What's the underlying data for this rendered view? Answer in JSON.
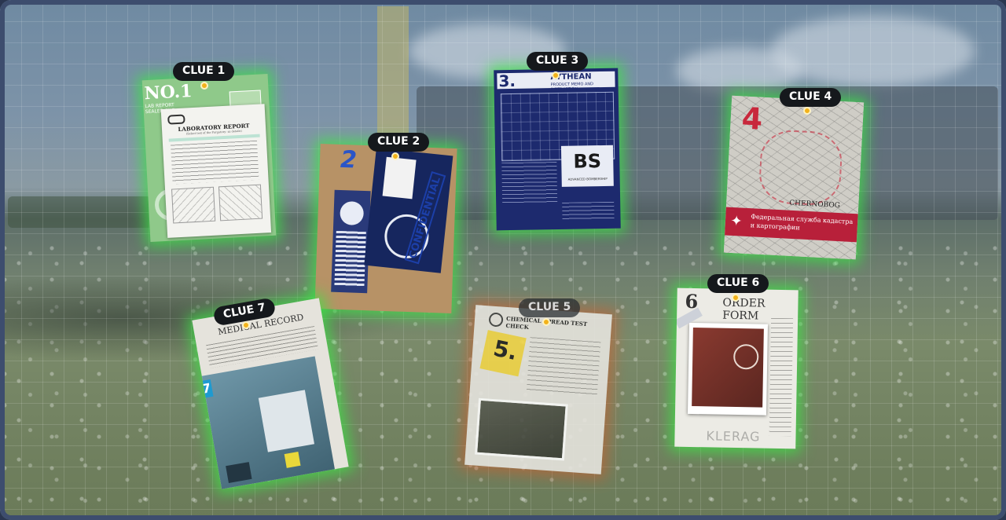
{
  "board": {
    "title": ""
  },
  "colors": {
    "found_glow": "#3ce646",
    "pending_glow": "#dc5a28",
    "pin": "#f2b21b",
    "pill": "#15181c"
  },
  "clues": [
    {
      "id": 1,
      "label": "CLUE 1",
      "badge": "NO.1",
      "subtitle": "LAB REPORT SEALED FILE",
      "doc_title": "LABORATORY REPORT",
      "doc_sub": "(Select test of the Purgatory: xx details)"
    },
    {
      "id": 2,
      "label": "CLUE 2",
      "number": "2",
      "stamp": "CONFIDENTIAL"
    },
    {
      "id": 3,
      "label": "CLUE 3",
      "number": "3.",
      "brand": "AYTHEAN",
      "doc_sub": "PRODUCT MEMO AND INSTRUCTION",
      "logo": "BS",
      "logo_sub": "ADVANCED BOMBERSHIP"
    },
    {
      "id": 4,
      "label": "CLUE 4",
      "number": "4",
      "map_place": "CHERNOBOG",
      "banner": "Федеральная служба кадастра и картографии"
    },
    {
      "id": 5,
      "label": "CLUE 5",
      "number": "5.",
      "header": "CHEMICAL SPREAD TEST CHECK"
    },
    {
      "id": 6,
      "label": "CLUE 6",
      "number": "6",
      "doc_title": "ORDER FORM",
      "stamp": "KLERAG"
    },
    {
      "id": 7,
      "label": "CLUE 7",
      "number": "7",
      "doc_title": "MEDICAL RECORD"
    }
  ]
}
